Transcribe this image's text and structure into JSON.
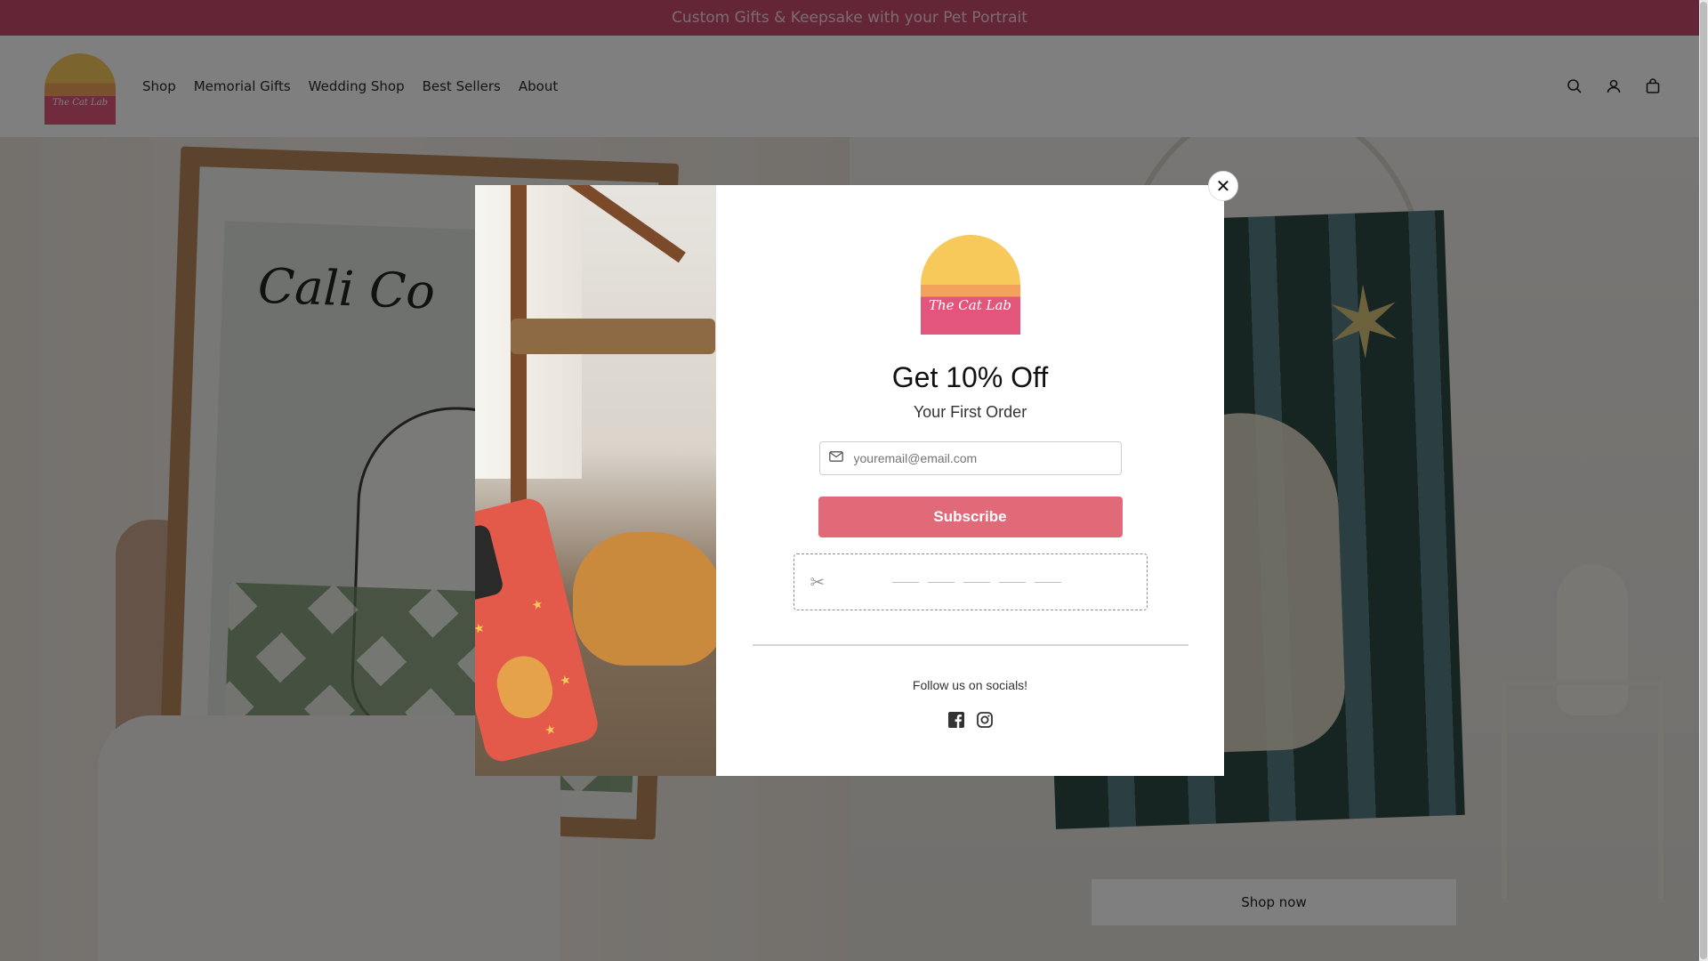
{
  "announcement": "Custom Gifts & Keepsake with your Pet Portrait",
  "brand": {
    "logo_text": "The Cat Lab"
  },
  "nav": [
    "Shop",
    "Memorial Gifts",
    "Wedding Shop",
    "Best Sellers",
    "About"
  ],
  "header_icons": [
    "search-icon",
    "account-icon",
    "cart-icon"
  ],
  "hero": {
    "left_frame_text": "Cali Co",
    "cta": "Shop now"
  },
  "popup": {
    "logo_text": "The Cat Lab",
    "title": "Get 10% Off",
    "subtitle": "Your First Order",
    "email_placeholder": "youremail@email.com",
    "subscribe_label": "Subscribe",
    "follow_text": "Follow us on socials!",
    "socials": [
      "facebook-icon",
      "instagram-icon"
    ],
    "close_label": "✕"
  },
  "colors": {
    "announcement_bg": "#c94b6e",
    "subscribe_bg": "#e16a79",
    "overlay": "rgba(0,0,0,0.5)"
  }
}
